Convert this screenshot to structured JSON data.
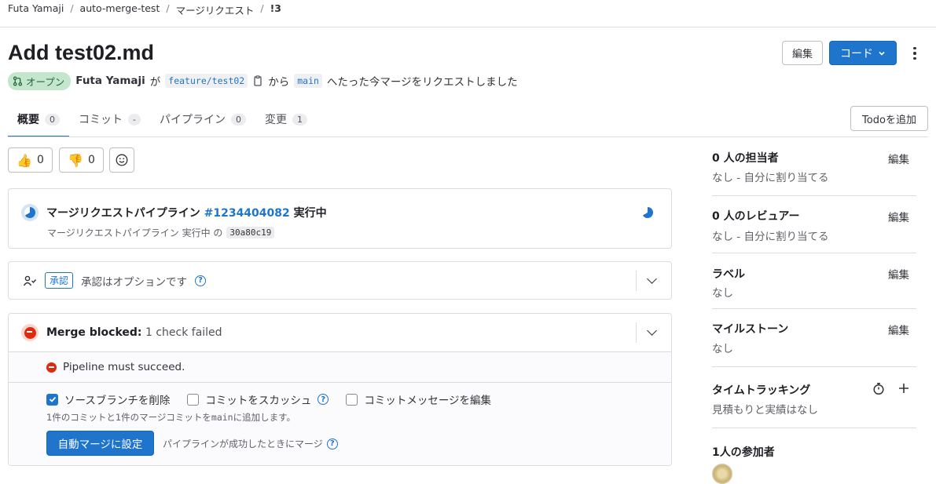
{
  "breadcrumb": [
    "Futa Yamaji",
    "auto-merge-test",
    "マージリクエスト",
    "!3"
  ],
  "header": {
    "title": "Add test02.md",
    "edit_label": "編集",
    "code_label": "コード"
  },
  "meta": {
    "status": "オープン",
    "author": "Futa Yamaji",
    "text_ga": "が",
    "source_branch": "feature/test02",
    "text_kara": "から",
    "target_branch": "main",
    "text_tail": "へたった今マージをリクエストしました"
  },
  "tabs": [
    {
      "label": "概要",
      "count": "0"
    },
    {
      "label": "コミット",
      "count": "-"
    },
    {
      "label": "パイプライン",
      "count": "0"
    },
    {
      "label": "変更",
      "count": "1"
    }
  ],
  "todo_label": "Todoを追加",
  "reactions": {
    "thumbs_up": "0",
    "thumbs_down": "0"
  },
  "pipeline": {
    "title_prefix": "マージリクエストパイプライン",
    "id": "#1234404082",
    "status": "実行中",
    "sub_text": "マージリクエストパイプライン 実行中 の",
    "commit": "30a80c19"
  },
  "approval": {
    "badge": "承認",
    "text": "承認はオプションです"
  },
  "merge": {
    "blocked_label": "Merge blocked:",
    "blocked_detail": "1 check failed",
    "check": "Pipeline must succeed.",
    "opt_delete_branch": "ソースブランチを削除",
    "opt_squash": "コミットをスカッシュ",
    "opt_edit_message": "コミットメッセージを編集",
    "commit_info_a": "1件のコミットと1件のマージコミットを",
    "commit_info_branch": "main",
    "commit_info_b": "に追加します。",
    "auto_merge_button": "自動マージに設定",
    "auto_merge_hint": "パイプラインが成功したときにマージ"
  },
  "sidebar": {
    "assignees": {
      "title": "0 人の担当者",
      "edit": "編集",
      "value": "なし - 自分に割り当てる"
    },
    "reviewers": {
      "title": "0 人のレビュアー",
      "edit": "編集",
      "value": "なし - 自分に割り当てる"
    },
    "labels": {
      "title": "ラベル",
      "edit": "編集",
      "value": "なし"
    },
    "milestone": {
      "title": "マイルストーン",
      "edit": "編集",
      "value": "なし"
    },
    "time_tracking": {
      "title": "タイムトラッキング",
      "value": "見積もりと実績はなし"
    },
    "participants": {
      "title": "1人の参加者"
    }
  },
  "colors": {
    "accent": "#1f75cb",
    "open_badge_bg": "#c3e6cd",
    "danger": "#dd2b0e"
  }
}
